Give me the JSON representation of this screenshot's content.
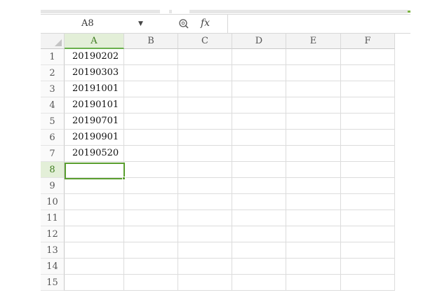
{
  "formula_bar": {
    "name_box": "A8",
    "fx_label": "fx",
    "formula_value": ""
  },
  "columns": [
    "A",
    "B",
    "C",
    "D",
    "E",
    "F"
  ],
  "rows": [
    "1",
    "2",
    "3",
    "4",
    "5",
    "6",
    "7",
    "8",
    "9",
    "10",
    "11",
    "12",
    "13",
    "14",
    "15"
  ],
  "cells": [
    [
      "20190202",
      "",
      "",
      "",
      "",
      ""
    ],
    [
      "20190303",
      "",
      "",
      "",
      "",
      ""
    ],
    [
      "20191001",
      "",
      "",
      "",
      "",
      ""
    ],
    [
      "20190101",
      "",
      "",
      "",
      "",
      ""
    ],
    [
      "20190701",
      "",
      "",
      "",
      "",
      ""
    ],
    [
      "20190901",
      "",
      "",
      "",
      "",
      ""
    ],
    [
      "20190520",
      "",
      "",
      "",
      "",
      ""
    ],
    [
      "",
      "",
      "",
      "",
      "",
      ""
    ],
    [
      "",
      "",
      "",
      "",
      "",
      ""
    ],
    [
      "",
      "",
      "",
      "",
      "",
      ""
    ],
    [
      "",
      "",
      "",
      "",
      "",
      ""
    ],
    [
      "",
      "",
      "",
      "",
      "",
      ""
    ],
    [
      "",
      "",
      "",
      "",
      "",
      ""
    ],
    [
      "",
      "",
      "",
      "",
      "",
      ""
    ],
    [
      "",
      "",
      "",
      "",
      "",
      ""
    ]
  ],
  "active_cell": {
    "row": 8,
    "col": "A"
  },
  "icons": {
    "name_box_dropdown": "chevron-down-icon",
    "zoom": "magnifier-icon",
    "function": "fx-icon",
    "select_all": "select-all-triangle-icon"
  },
  "colors": {
    "selection_accent": "#5a9e2f",
    "selected_header_bg": "#e3efd8"
  }
}
